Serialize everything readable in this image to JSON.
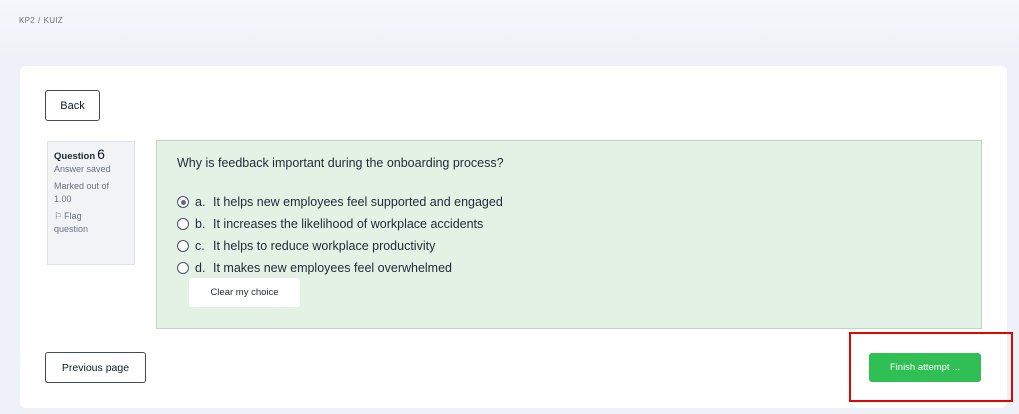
{
  "breadcrumb": {
    "course": "KP2",
    "separator": "/",
    "page": "KUIZ"
  },
  "nav": {
    "back_label": "Back",
    "previous_label": "Previous page",
    "finish_label": "Finish attempt ..."
  },
  "question_info": {
    "label": "Question",
    "number": "6",
    "status": "Answer saved",
    "marked_out_of": "Marked out of",
    "mark_value": "1.00",
    "flag_label": "Flag",
    "flag_label_2": "question"
  },
  "question": {
    "text": "Why is feedback important during the onboarding process?",
    "options": [
      {
        "letter": "a.",
        "text": "It helps new employees feel supported and engaged",
        "checked": true
      },
      {
        "letter": "b.",
        "text": "It increases the likelihood of workplace accidents",
        "checked": false
      },
      {
        "letter": "c.",
        "text": "It helps to reduce workplace productivity",
        "checked": false
      },
      {
        "letter": "d.",
        "text": "It makes new employees feel overwhelmed",
        "checked": false
      }
    ],
    "clear_label": "Clear my choice"
  },
  "colors": {
    "panel_bg": "#e4f2e6",
    "finish_bg": "#2fbf55",
    "highlight": "#e10600"
  },
  "icons": {
    "flag": "flag-icon"
  }
}
